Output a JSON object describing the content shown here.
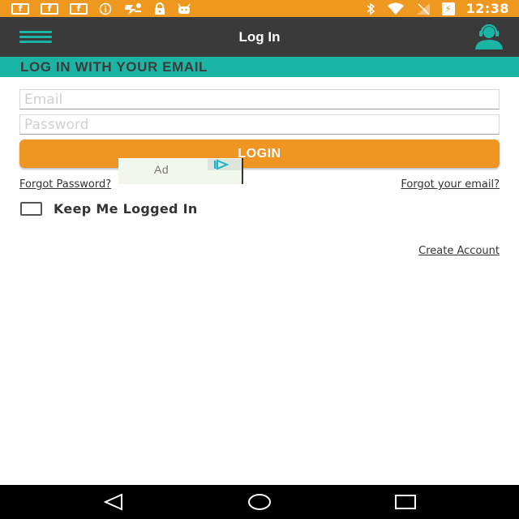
{
  "status_bar": {
    "left_icons": [
      "facebook-icon",
      "facebook-icon",
      "facebook-icon",
      "info-icon",
      "sports-app-icon",
      "lock-icon",
      "android-icon"
    ],
    "fb_letter": "f",
    "right_icons": [
      "bluetooth-icon",
      "wifi-icon",
      "no-signal-icon",
      "battery-charging-icon"
    ],
    "time": "12:38"
  },
  "app_bar": {
    "title": "Log In",
    "menu_icon": "hamburger-menu-icon",
    "support_icon": "support-agent-icon"
  },
  "section": {
    "header": "LOG IN WITH YOUR EMAIL"
  },
  "form": {
    "email_placeholder": "Email",
    "email_value": "",
    "password_placeholder": "Password",
    "password_value": "",
    "login_label": "LOGIN",
    "forgot_password": "Forgot Password?",
    "forgot_email": "Forgot your email?",
    "keep_logged_in": "Keep Me Logged In",
    "keep_logged_in_checked": false,
    "create_account": "Create Account"
  },
  "ad": {
    "label": "Ad",
    "icon": "ad-choices-icon"
  },
  "nav_bar": {
    "back": "back-triangle-icon",
    "home": "home-circle-icon",
    "recent": "recent-apps-square-icon"
  },
  "colors": {
    "status_bar": "#ee9820",
    "app_bar": "#3a3a3a",
    "accent_teal": "#1ab5a4",
    "login_button": "#ee9522",
    "nav_bar": "#000000"
  }
}
